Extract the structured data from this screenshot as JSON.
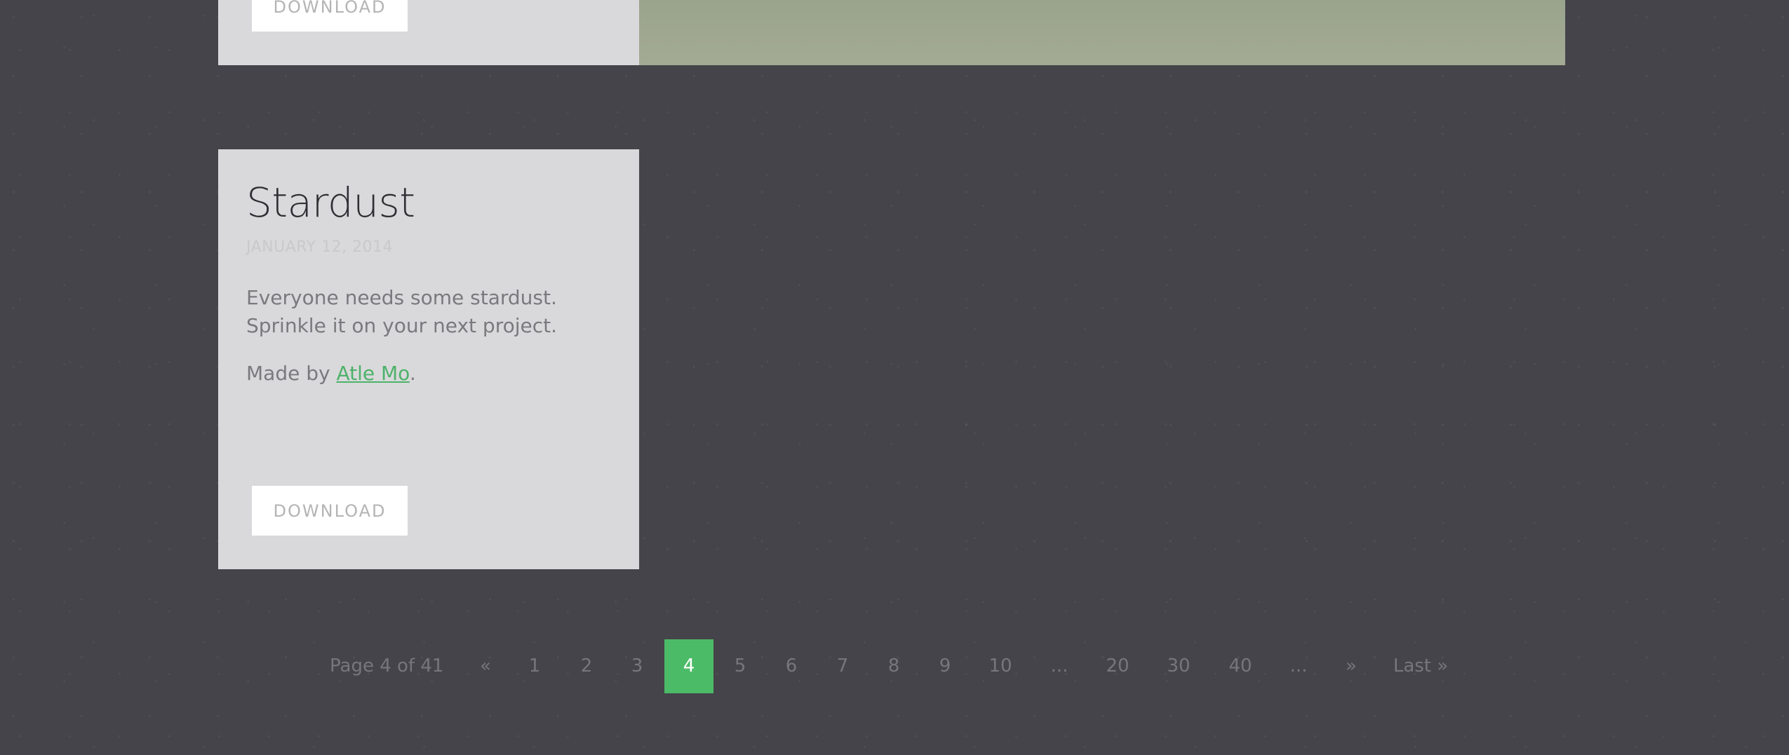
{
  "top_card": {
    "download_label": "DOWNLOAD"
  },
  "main_card": {
    "title": "Stardust",
    "date": "JANUARY 12, 2014",
    "description": "Everyone needs some stardust. Sprinkle it on your next project.",
    "credit_prefix": "Made by ",
    "credit_author": "Atle Mo",
    "credit_suffix": ".",
    "download_label": "DOWNLOAD"
  },
  "pagination": {
    "status": "Page 4 of 41",
    "prev": "«",
    "pages": [
      "1",
      "2",
      "3",
      "4",
      "5",
      "6",
      "7",
      "8",
      "9",
      "10"
    ],
    "current_page": "4",
    "ellipsis": "...",
    "extended_pages": [
      "20",
      "30",
      "40"
    ],
    "next": "»",
    "last": "Last »"
  },
  "colors": {
    "background": "#45444a",
    "card": "#d9d9db",
    "accent_green": "#4cbb68",
    "link_green": "#4db26a"
  }
}
